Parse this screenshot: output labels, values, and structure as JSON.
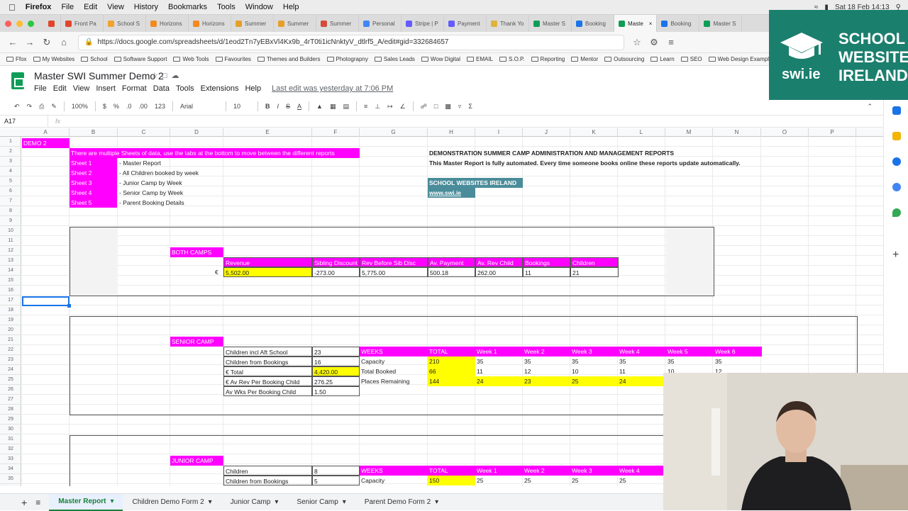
{
  "macbar": {
    "app": "Firefox",
    "menus": [
      "File",
      "Edit",
      "View",
      "History",
      "Bookmarks",
      "Tools",
      "Window",
      "Help"
    ],
    "datetime": "Sat 18 Feb 14:13"
  },
  "browser_tabs": [
    {
      "label": "Front Pa",
      "color": "#e0452b"
    },
    {
      "label": "School S",
      "color": "#f3a22b"
    },
    {
      "label": "Horizons",
      "color": "#f28a1e"
    },
    {
      "label": "Horizons",
      "color": "#f28a1e"
    },
    {
      "label": "Summer",
      "color": "#e79f29"
    },
    {
      "label": "Summer",
      "color": "#e79f29"
    },
    {
      "label": "Summer",
      "color": "#d44b3a"
    },
    {
      "label": "Personal",
      "color": "#4285f4"
    },
    {
      "label": "Stripe | P",
      "color": "#635bff"
    },
    {
      "label": "Payment",
      "color": "#635bff"
    },
    {
      "label": "Thank Yo",
      "color": "#e0b23a"
    },
    {
      "label": "Master S",
      "color": "#0f9d58"
    },
    {
      "label": "Booking",
      "color": "#1a73e8"
    },
    {
      "label": "Maste",
      "color": "#0f9d58",
      "active": true
    },
    {
      "label": "Booking",
      "color": "#1a73e8"
    },
    {
      "label": "Master S",
      "color": "#0f9d58"
    }
  ],
  "url": "https://docs.google.com/spreadsheets/d/1eod2Tn7yEBxVl4Kx9b_4rT0ti1icNnktyV_dtlrf5_A/edit#gid=332684657",
  "bookmarks": [
    "Ffox",
    "My Websites",
    "School",
    "Software Support",
    "Web Tools",
    "Favourites",
    "Themes and Builders",
    "Photograpny",
    "Sales Leads",
    "Wow Digital",
    "EMAIL",
    "S.O.P.",
    "Reporting",
    "Mentor",
    "Outsourcing",
    "Learn",
    "SEO",
    "Web Design Exampl..."
  ],
  "doc": {
    "title": "Master SWI Summer Demo 2",
    "menus": [
      "File",
      "Edit",
      "View",
      "Insert",
      "Format",
      "Data",
      "Tools",
      "Extensions",
      "Help"
    ],
    "last_edit": "Last edit was yesterday at 7:06 PM"
  },
  "toolbar": {
    "zoom": "100%",
    "currency": "$",
    "percent": "%",
    "dec_less": ".0",
    "dec_more": ".00",
    "format": "123",
    "font": "Arial",
    "size": "10"
  },
  "formula": {
    "cell_ref": "A17"
  },
  "columns": [
    "A",
    "B",
    "C",
    "D",
    "E",
    "F",
    "G",
    "H",
    "I",
    "J",
    "K",
    "L",
    "M",
    "N",
    "O",
    "P"
  ],
  "rows": [
    "1",
    "2",
    "3",
    "4",
    "5",
    "6",
    "7",
    "8",
    "9",
    "10",
    "11",
    "12",
    "13",
    "14",
    "15",
    "16",
    "17",
    "18",
    "19",
    "20",
    "21",
    "22",
    "23",
    "24",
    "25",
    "26",
    "27",
    "28",
    "29",
    "30",
    "31",
    "32",
    "33",
    "34",
    "35"
  ],
  "sheet": {
    "a1": "DEMO 2",
    "intro": "There are multiple Sheets of data, use the tabs at the bottom to move between the different reports",
    "sheets_list": [
      {
        "name": "Sheet 1",
        "desc": "- Master Report"
      },
      {
        "name": "Sheet 2",
        "desc": "- All Children booked by week"
      },
      {
        "name": "Sheet 3",
        "desc": "- Junior Camp by Week"
      },
      {
        "name": "Sheet 4",
        "desc": "- Senior Camp by Week"
      },
      {
        "name": "Sheet 5",
        "desc": "- Parent Booking Details"
      }
    ],
    "demo_title": "DEMONSTRATION SUMMER CAMP ADMINISTRATION AND MANAGEMENT REPORTS",
    "demo_sub": "This Master Report is fully automated. Every time someone books online these reports update automatically.",
    "swi_name": "SCHOOL WEBSITES IRELAND",
    "swi_url": "www.swi.ie",
    "both": {
      "title": "BOTH CAMPS",
      "headers": [
        "Revenue",
        "Sibling Discount",
        "Rev Before Sib Disc",
        "Av. Payment",
        "Av. Rev Child",
        "Bookings",
        "Children"
      ],
      "currency": "€",
      "values": [
        "5,502.00",
        "-273.00",
        "5,775.00",
        "500.18",
        "262.00",
        "11",
        "21"
      ]
    },
    "senior": {
      "title": "SENIOR CAMP",
      "stats": [
        {
          "label": "Children incl Aft School",
          "value": "23"
        },
        {
          "label": "Children from Bookings",
          "value": "16"
        },
        {
          "label": "€ Total",
          "value": "4,420.00"
        },
        {
          "label": "€ Av Rev Per Booking Child",
          "value": "276.25"
        },
        {
          "label": "Av Wks Per Booking Child",
          "value": "1.50"
        }
      ],
      "weeks_header": [
        "WEEKS",
        "TOTAL",
        "Week 1",
        "Week 2",
        "Week 3",
        "Week 4",
        "Week 5",
        "Week 6"
      ],
      "capacity": [
        "Capacity",
        "210",
        "35",
        "35",
        "35",
        "35",
        "35",
        "35"
      ],
      "total_booked": [
        "Total Booked",
        "66",
        "11",
        "12",
        "10",
        "11",
        "10",
        "12"
      ],
      "remaining": [
        "Places Remaining",
        "144",
        "24",
        "23",
        "25",
        "24"
      ]
    },
    "junior": {
      "title": "JUNIOR CAMP",
      "stats": [
        {
          "label": "Children",
          "value": "8"
        },
        {
          "label": "Children from Bookings",
          "value": "5"
        }
      ],
      "weeks_header": [
        "WEEKS",
        "TOTAL",
        "Week 1",
        "Week 2",
        "Week 3",
        "Week 4"
      ],
      "capacity": [
        "Capacity",
        "150",
        "25",
        "25",
        "25",
        "25"
      ]
    }
  },
  "sheet_tabs": [
    "Master Report",
    "Children Demo Form 2",
    "Junior Camp",
    "Senior Camp",
    "Parent Demo Form 2"
  ],
  "logo": {
    "site": "swi.ie",
    "line1": "SCHOOL",
    "line2": "WEBSITES",
    "line3": "IRELAND",
    "bg": "#1b7f6e"
  }
}
